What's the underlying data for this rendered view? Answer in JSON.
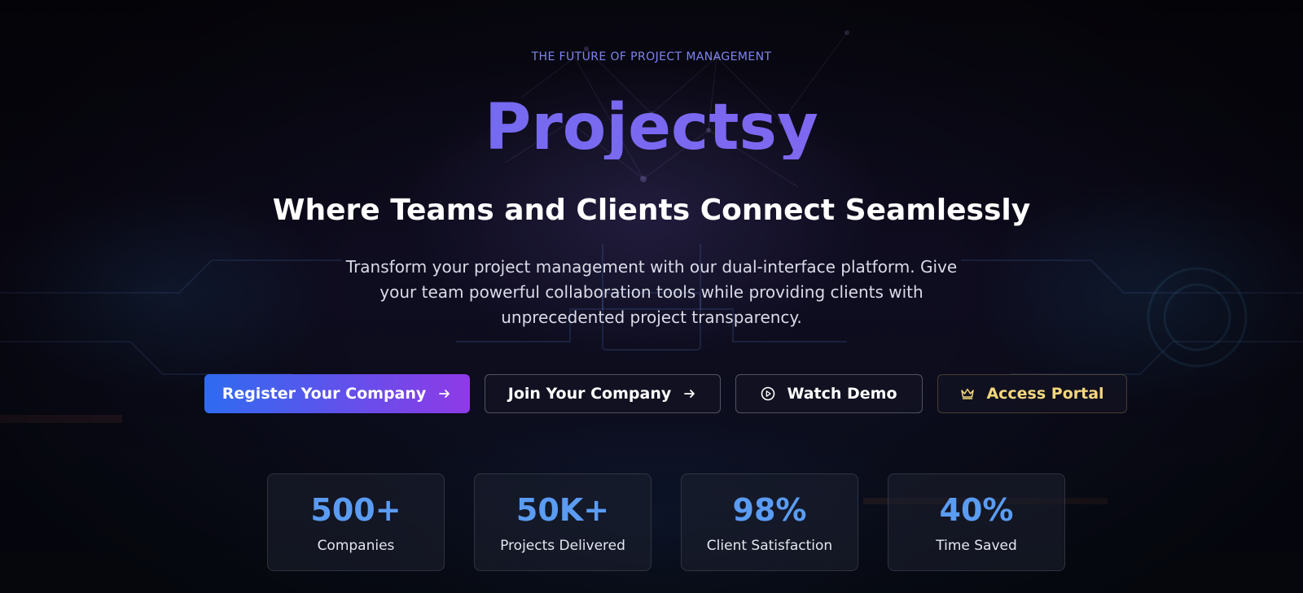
{
  "hero": {
    "eyebrow": "THE FUTURE OF PROJECT MANAGEMENT",
    "brand": "Projectsy",
    "tagline": "Where Teams and Clients Connect Seamlessly",
    "description": "Transform your project management with our dual-interface platform. Give your team powerful collaboration tools while providing clients with unprecedented project transparency."
  },
  "buttons": {
    "register": {
      "label": "Register Your Company",
      "icon": "arrow-right-icon"
    },
    "join": {
      "label": "Join Your Company",
      "icon": "arrow-right-icon"
    },
    "demo": {
      "label": "Watch Demo",
      "icon": "play-circle-icon"
    },
    "portal": {
      "label": "Access Portal",
      "icon": "crown-icon"
    }
  },
  "stats": [
    {
      "value": "500+",
      "label": "Companies"
    },
    {
      "value": "50K+",
      "label": "Projects Delivered"
    },
    {
      "value": "98%",
      "label": "Client Satisfaction"
    },
    {
      "value": "40%",
      "label": "Time Saved"
    }
  ],
  "colors": {
    "primary_gradient_start": "#2f6bf0",
    "primary_gradient_end": "#8f3ae6",
    "stat_value": "#5b9cf3",
    "portal_accent": "#f4d77d",
    "background": "#0b0a17"
  }
}
